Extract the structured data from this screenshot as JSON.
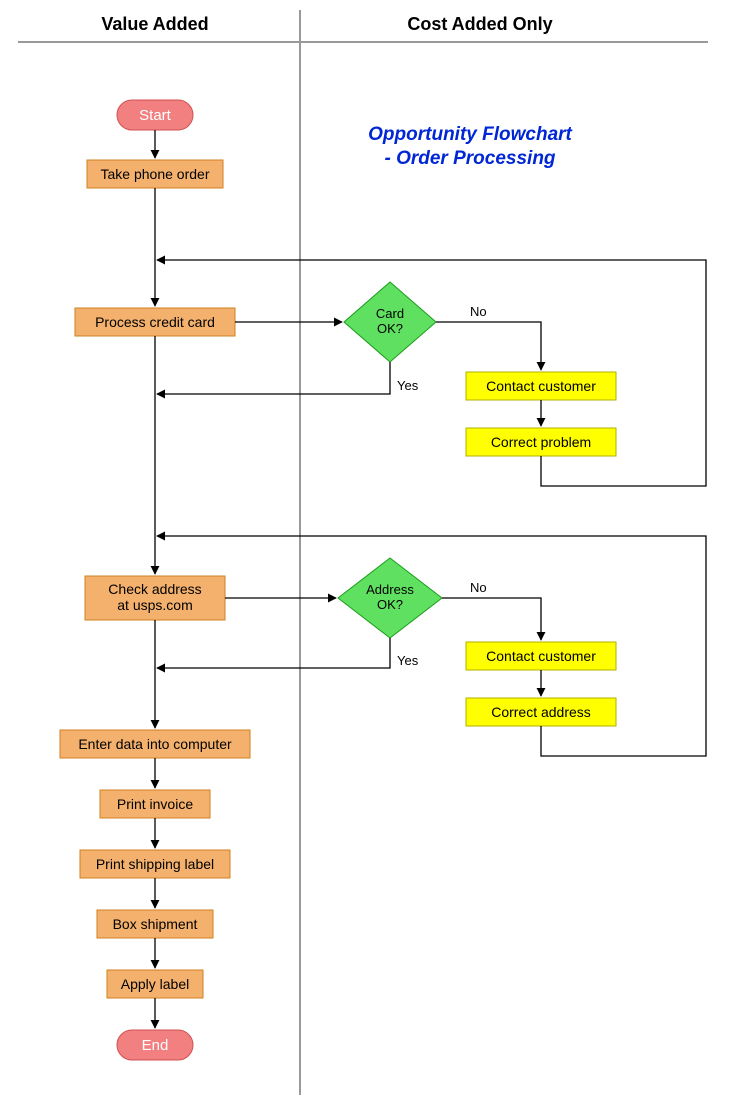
{
  "headers": {
    "left": "Value Added",
    "right": "Cost Added Only"
  },
  "title": {
    "line1": "Opportunity Flowchart",
    "line2": "- Order Processing"
  },
  "nodes": {
    "start": "Start",
    "take_order": "Take phone order",
    "process_card": "Process credit card",
    "card_ok_l1": "Card",
    "card_ok_l2": "OK?",
    "contact_customer": "Contact customer",
    "correct_problem": "Correct problem",
    "check_addr_l1": "Check address",
    "check_addr_l2": "at usps.com",
    "addr_ok_l1": "Address",
    "addr_ok_l2": "OK?",
    "contact_customer2": "Contact customer",
    "correct_address": "Correct address",
    "enter_data": "Enter data into computer",
    "print_invoice": "Print invoice",
    "print_label": "Print shipping label",
    "box": "Box shipment",
    "apply_label": "Apply label",
    "end": "End"
  },
  "labels": {
    "yes": "Yes",
    "no": "No"
  },
  "chart_data": {
    "type": "flowchart",
    "swimlanes": [
      "Value Added",
      "Cost Added Only"
    ],
    "nodes": [
      {
        "id": "start",
        "type": "terminal",
        "label": "Start",
        "lane": "Value Added"
      },
      {
        "id": "take_order",
        "type": "process",
        "label": "Take phone order",
        "lane": "Value Added"
      },
      {
        "id": "process_card",
        "type": "process",
        "label": "Process credit card",
        "lane": "Value Added"
      },
      {
        "id": "card_ok",
        "type": "decision",
        "label": "Card OK?",
        "lane": "Cost Added Only"
      },
      {
        "id": "contact_customer",
        "type": "process",
        "label": "Contact customer",
        "lane": "Cost Added Only"
      },
      {
        "id": "correct_problem",
        "type": "process",
        "label": "Correct problem",
        "lane": "Cost Added Only"
      },
      {
        "id": "check_addr",
        "type": "process",
        "label": "Check address at usps.com",
        "lane": "Value Added"
      },
      {
        "id": "addr_ok",
        "type": "decision",
        "label": "Address OK?",
        "lane": "Cost Added Only"
      },
      {
        "id": "contact_customer2",
        "type": "process",
        "label": "Contact customer",
        "lane": "Cost Added Only"
      },
      {
        "id": "correct_address",
        "type": "process",
        "label": "Correct address",
        "lane": "Cost Added Only"
      },
      {
        "id": "enter_data",
        "type": "process",
        "label": "Enter data into computer",
        "lane": "Value Added"
      },
      {
        "id": "print_invoice",
        "type": "process",
        "label": "Print invoice",
        "lane": "Value Added"
      },
      {
        "id": "print_label",
        "type": "process",
        "label": "Print shipping label",
        "lane": "Value Added"
      },
      {
        "id": "box",
        "type": "process",
        "label": "Box shipment",
        "lane": "Value Added"
      },
      {
        "id": "apply_label",
        "type": "process",
        "label": "Apply label",
        "lane": "Value Added"
      },
      {
        "id": "end",
        "type": "terminal",
        "label": "End",
        "lane": "Value Added"
      }
    ],
    "edges": [
      {
        "from": "start",
        "to": "take_order"
      },
      {
        "from": "take_order",
        "to": "process_card"
      },
      {
        "from": "process_card",
        "to": "card_ok"
      },
      {
        "from": "card_ok",
        "to": "contact_customer",
        "label": "No"
      },
      {
        "from": "contact_customer",
        "to": "correct_problem"
      },
      {
        "from": "correct_problem",
        "to": "process_card"
      },
      {
        "from": "card_ok",
        "to": "check_addr",
        "label": "Yes"
      },
      {
        "from": "check_addr",
        "to": "addr_ok"
      },
      {
        "from": "addr_ok",
        "to": "contact_customer2",
        "label": "No"
      },
      {
        "from": "contact_customer2",
        "to": "correct_address"
      },
      {
        "from": "correct_address",
        "to": "check_addr"
      },
      {
        "from": "addr_ok",
        "to": "enter_data",
        "label": "Yes"
      },
      {
        "from": "enter_data",
        "to": "print_invoice"
      },
      {
        "from": "print_invoice",
        "to": "print_label"
      },
      {
        "from": "print_label",
        "to": "box"
      },
      {
        "from": "box",
        "to": "apply_label"
      },
      {
        "from": "apply_label",
        "to": "end"
      }
    ]
  }
}
